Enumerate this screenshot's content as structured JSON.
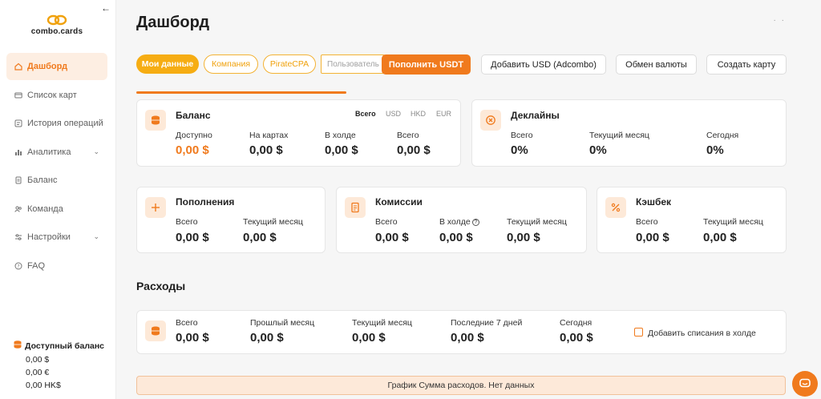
{
  "brand": {
    "name": "combo.cards",
    "accent": "#f07a1d",
    "tab_accent": "#f6ad13"
  },
  "sidebar": {
    "collapse_icon": "arrow-left-icon",
    "items": [
      {
        "label": "Дашборд",
        "icon": "home-icon",
        "active": true
      },
      {
        "label": "Список карт",
        "icon": "card-icon"
      },
      {
        "label": "История операций",
        "icon": "history-icon"
      },
      {
        "label": "Аналитика",
        "icon": "chart-icon",
        "has_submenu": true
      },
      {
        "label": "Баланс",
        "icon": "document-icon"
      },
      {
        "label": "Команда",
        "icon": "team-icon"
      },
      {
        "label": "Настройки",
        "icon": "settings-icon",
        "has_submenu": true
      },
      {
        "label": "FAQ",
        "icon": "question-icon"
      }
    ],
    "available_balance": {
      "title": "Доступный баланс",
      "lines": [
        "0,00 $",
        "0,00 €",
        "0,00 HK$"
      ]
    }
  },
  "header": {
    "title": "Дашборд"
  },
  "tabs": [
    {
      "label": "Мои данные",
      "active": true
    },
    {
      "label": "Компания"
    },
    {
      "label": "PirateCPA"
    }
  ],
  "user_filter": {
    "placeholder": "Пользователь"
  },
  "actions": {
    "topup_usdt": "Пополнить USDT",
    "add_usd": "Добавить USD (Adcombo)",
    "exchange": "Обмен валюты",
    "create_card": "Создать карту"
  },
  "balance_card": {
    "title": "Баланс",
    "currency_tabs": [
      "Всего",
      "USD",
      "HKD",
      "EUR"
    ],
    "active_currency": "Всего",
    "stats": [
      {
        "label": "Доступно",
        "value": "0,00 $"
      },
      {
        "label": "На картах",
        "value": "0,00 $"
      },
      {
        "label": "В холде",
        "value": "0,00 $"
      },
      {
        "label": "Всего",
        "value": "0,00 $"
      }
    ]
  },
  "declines_card": {
    "title": "Деклайны",
    "stats": [
      {
        "label": "Всего",
        "value": "0%"
      },
      {
        "label": "Текущий месяц",
        "value": "0%"
      },
      {
        "label": "Сегодня",
        "value": "0%"
      }
    ]
  },
  "topups_card": {
    "title": "Пополнения",
    "stats": [
      {
        "label": "Всего",
        "value": "0,00 $"
      },
      {
        "label": "Текущий месяц",
        "value": "0,00 $"
      }
    ]
  },
  "fees_card": {
    "title": "Комиссии",
    "stats": [
      {
        "label": "Всего",
        "value": "0,00 $"
      },
      {
        "label": "В холде",
        "value": "0,00 $"
      },
      {
        "label": "Текущий месяц",
        "value": "0,00 $"
      }
    ]
  },
  "cashback_card": {
    "title": "Кэшбек",
    "stats": [
      {
        "label": "Всего",
        "value": "0,00 $"
      },
      {
        "label": "Текущий месяц",
        "value": "0,00 $"
      }
    ]
  },
  "expenses": {
    "section_title": "Расходы",
    "stats": [
      {
        "label": "Всего",
        "value": "0,00 $"
      },
      {
        "label": "Прошлый месяц",
        "value": "0,00 $"
      },
      {
        "label": "Текущий месяц",
        "value": "0,00 $"
      },
      {
        "label": "Последние 7 дней",
        "value": "0,00 $"
      },
      {
        "label": "Сегодня",
        "value": "0,00 $"
      }
    ],
    "hold_checkbox_label": "Добавить списания в холде",
    "hold_checkbox_checked": false
  },
  "chart_notice": "График Сумма расходов. Нет данных"
}
